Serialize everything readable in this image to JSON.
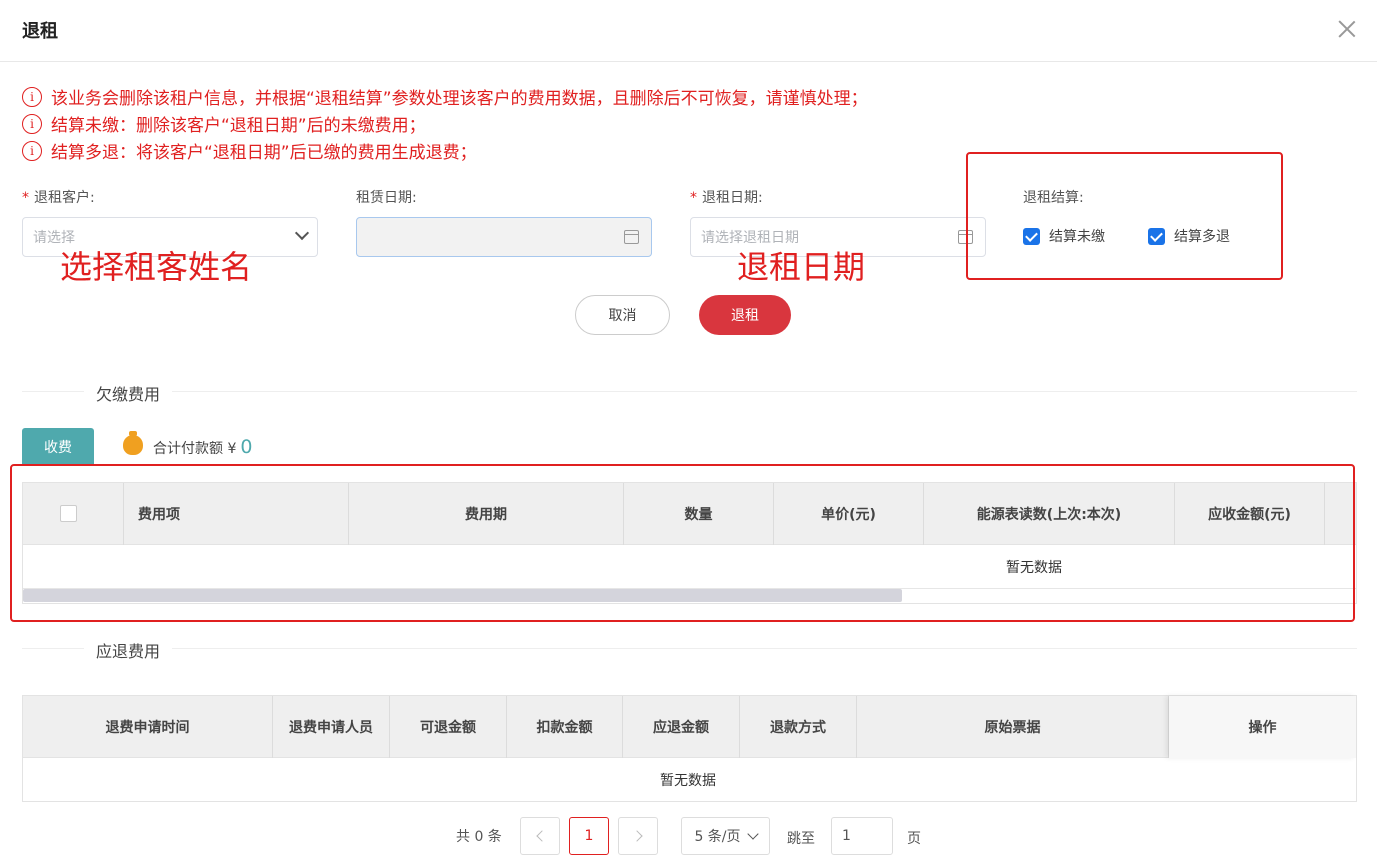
{
  "dialog": {
    "title": "退租"
  },
  "notices": [
    "该业务会删除该租户信息，并根据“退租结算”参数处理该客户的费用数据，且删除后不可恢复，请谨慎处理；",
    "结算未缴：删除该客户“退租日期”后的未缴费用；",
    "结算多退：将该客户“退租日期”后已缴的费用生成退费；"
  ],
  "form": {
    "tenant_label": "退租客户:",
    "tenant_placeholder": "请选择",
    "lease_date_label": "租赁日期:",
    "checkout_date_label": "退租日期:",
    "checkout_date_placeholder": "请选择退租日期",
    "settlement_label": "退租结算:",
    "settle_unpaid": "结算未缴",
    "settle_overpaid": "结算多退",
    "required_mark": "*"
  },
  "annotations": {
    "tenant_hint": "选择租客姓名",
    "date_hint": "退租日期"
  },
  "actions": {
    "cancel": "取消",
    "submit": "退租"
  },
  "arrears": {
    "section_title": "欠缴费用",
    "tab_label": "收费",
    "total_label": "合计付款额 ¥",
    "total_value": "0",
    "columns": [
      "费用项",
      "费用期",
      "数量",
      "单价(元)",
      "能源表读数(上次:本次)",
      "应收金额(元)"
    ],
    "empty_text": "暂无数据"
  },
  "refunds": {
    "section_title": "应退费用",
    "columns": [
      "退费申请时间",
      "退费申请人员",
      "可退金额",
      "扣款金额",
      "应退金额",
      "退款方式",
      "原始票据",
      "操作"
    ],
    "empty_text": "暂无数据"
  },
  "pagination": {
    "total_text": "共 0 条",
    "current_page": "1",
    "page_size": "5 条/页",
    "goto_label": "跳至",
    "goto_value": "1",
    "page_unit": "页"
  },
  "colors": {
    "accent": "#d9363e",
    "teal": "#4fa9ad",
    "warning": "#e02020",
    "checkbox": "#1a73e8"
  }
}
